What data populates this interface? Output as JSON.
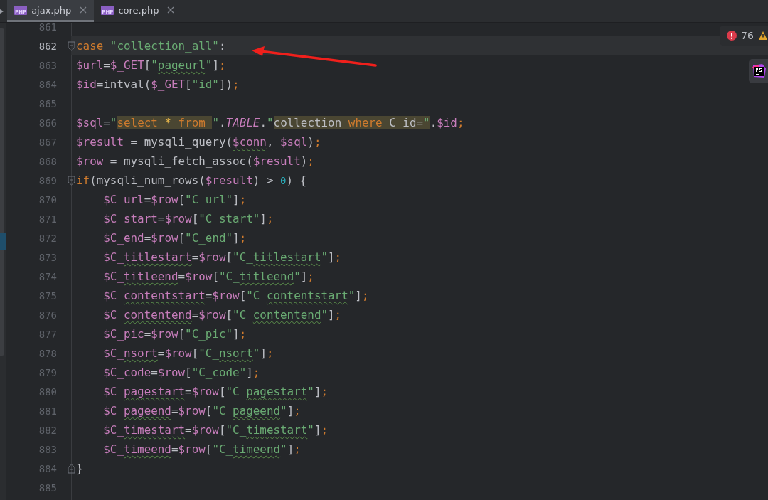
{
  "tabs": [
    {
      "label": "ajax.php",
      "badge": "PHP",
      "selected": true
    },
    {
      "label": "core.php",
      "badge": "PHP",
      "selected": false
    }
  ],
  "inspections": {
    "errors": "76"
  },
  "lines": [
    {
      "number": "861",
      "current": false,
      "fold_start": false,
      "fold_end": false
    },
    {
      "number": "862",
      "current": true,
      "fold_start": true,
      "fold_end": false,
      "tokens": [
        {
          "text": "case ",
          "kind": "kw"
        },
        {
          "text": "\"collection_all\"",
          "kind": "str"
        },
        {
          "text": ":",
          "kind": "plain"
        }
      ]
    },
    {
      "number": "863",
      "current": false,
      "fold_start": false,
      "fold_end": false,
      "tokens": [
        {
          "text": "$url",
          "kind": "var"
        },
        {
          "text": "=",
          "kind": "plain"
        },
        {
          "text": "$_GET",
          "kind": "var"
        },
        {
          "text": "[",
          "kind": "plain"
        },
        {
          "text": "\"",
          "kind": "str"
        },
        {
          "text": "pageurl",
          "kind": "str_typo"
        },
        {
          "text": "\"",
          "kind": "str"
        },
        {
          "text": "]",
          "kind": "plain"
        },
        {
          "text": ";",
          "kind": "punct"
        }
      ]
    },
    {
      "number": "864",
      "current": false,
      "fold_start": false,
      "fold_end": false,
      "tokens": [
        {
          "text": "$id",
          "kind": "var"
        },
        {
          "text": "=intval(",
          "kind": "plain"
        },
        {
          "text": "$_GET",
          "kind": "var"
        },
        {
          "text": "[",
          "kind": "plain"
        },
        {
          "text": "\"id\"",
          "kind": "str"
        },
        {
          "text": "])",
          "kind": "plain"
        },
        {
          "text": ";",
          "kind": "punct"
        }
      ]
    },
    {
      "number": "865",
      "current": false,
      "fold_start": false,
      "fold_end": false
    },
    {
      "number": "866",
      "current": false,
      "fold_start": false,
      "fold_end": false,
      "tokens": [
        {
          "text": "$sql",
          "kind": "var"
        },
        {
          "text": "=",
          "kind": "plain"
        },
        {
          "text": "\"",
          "kind": "str"
        },
        {
          "text": "select ",
          "kind": "sqlkw"
        },
        {
          "text": "* ",
          "kind": "sqlstar"
        },
        {
          "text": "from ",
          "kind": "sqlkw"
        },
        {
          "text": "\"",
          "kind": "str"
        },
        {
          "text": ".",
          "kind": "plain"
        },
        {
          "text": "TABLE",
          "kind": "const"
        },
        {
          "text": ".",
          "kind": "plain"
        },
        {
          "text": "\"",
          "kind": "str"
        },
        {
          "text": "collection ",
          "kind": "sqltext"
        },
        {
          "text": "where",
          "kind": "sqlkw"
        },
        {
          "text": " C_id=",
          "kind": "sqltext"
        },
        {
          "text": "\"",
          "kind": "sqlquote"
        },
        {
          "text": ".",
          "kind": "plain"
        },
        {
          "text": "$id",
          "kind": "var"
        },
        {
          "text": ";",
          "kind": "punct"
        }
      ]
    },
    {
      "number": "867",
      "current": false,
      "fold_start": false,
      "fold_end": false,
      "tokens": [
        {
          "text": "$result",
          "kind": "var"
        },
        {
          "text": " = mysqli_query(",
          "kind": "plain"
        },
        {
          "text": "$conn",
          "kind": "var_typo"
        },
        {
          "text": ", ",
          "kind": "plain"
        },
        {
          "text": "$sql",
          "kind": "var"
        },
        {
          "text": ")",
          "kind": "plain"
        },
        {
          "text": ";",
          "kind": "punct"
        }
      ]
    },
    {
      "number": "868",
      "current": false,
      "fold_start": false,
      "fold_end": false,
      "tokens": [
        {
          "text": "$row",
          "kind": "var"
        },
        {
          "text": " = mysqli_fetch_assoc(",
          "kind": "plain"
        },
        {
          "text": "$result",
          "kind": "var"
        },
        {
          "text": ")",
          "kind": "plain"
        },
        {
          "text": ";",
          "kind": "punct"
        }
      ]
    },
    {
      "number": "869",
      "current": false,
      "fold_start": true,
      "fold_end": false,
      "tokens": [
        {
          "text": "if",
          "kind": "kw"
        },
        {
          "text": "(mysqli_num_rows(",
          "kind": "plain"
        },
        {
          "text": "$result",
          "kind": "var"
        },
        {
          "text": ") > ",
          "kind": "plain"
        },
        {
          "text": "0",
          "kind": "num"
        },
        {
          "text": ") {",
          "kind": "plain"
        }
      ],
      "children": [
        {
          "number": "870",
          "current": false,
          "fold_start": false,
          "fold_end": false,
          "tokens": [
            {
              "text": "$C_url",
              "kind": "var"
            },
            {
              "text": "=",
              "kind": "plain"
            },
            {
              "text": "$row",
              "kind": "var"
            },
            {
              "text": "[",
              "kind": "plain"
            },
            {
              "text": "\"C_url\"",
              "kind": "str"
            },
            {
              "text": "]",
              "kind": "plain"
            },
            {
              "text": ";",
              "kind": "punct"
            }
          ]
        },
        {
          "number": "871",
          "current": false,
          "fold_start": false,
          "fold_end": false,
          "tokens": [
            {
              "text": "$C_start",
              "kind": "var"
            },
            {
              "text": "=",
              "kind": "plain"
            },
            {
              "text": "$row",
              "kind": "var"
            },
            {
              "text": "[",
              "kind": "plain"
            },
            {
              "text": "\"C_start\"",
              "kind": "str"
            },
            {
              "text": "]",
              "kind": "plain"
            },
            {
              "text": ";",
              "kind": "punct"
            }
          ]
        },
        {
          "number": "872",
          "current": false,
          "fold_start": false,
          "fold_end": false,
          "tokens": [
            {
              "text": "$C_end",
              "kind": "var"
            },
            {
              "text": "=",
              "kind": "plain"
            },
            {
              "text": "$row",
              "kind": "var"
            },
            {
              "text": "[",
              "kind": "plain"
            },
            {
              "text": "\"C_end\"",
              "kind": "str"
            },
            {
              "text": "]",
              "kind": "plain"
            },
            {
              "text": ";",
              "kind": "punct"
            }
          ]
        },
        {
          "number": "873",
          "current": false,
          "fold_start": false,
          "fold_end": false,
          "tokens": [
            {
              "text": "$C_",
              "kind": "var"
            },
            {
              "text": "titlestart",
              "kind": "var_typo"
            },
            {
              "text": "=",
              "kind": "plain"
            },
            {
              "text": "$row",
              "kind": "var"
            },
            {
              "text": "[",
              "kind": "plain"
            },
            {
              "text": "\"C_",
              "kind": "str"
            },
            {
              "text": "titlestart",
              "kind": "str_typo"
            },
            {
              "text": "\"",
              "kind": "str"
            },
            {
              "text": "]",
              "kind": "plain"
            },
            {
              "text": ";",
              "kind": "punct"
            }
          ]
        },
        {
          "number": "874",
          "current": false,
          "fold_start": false,
          "fold_end": false,
          "tokens": [
            {
              "text": "$C_",
              "kind": "var"
            },
            {
              "text": "titleend",
              "kind": "var_typo"
            },
            {
              "text": "=",
              "kind": "plain"
            },
            {
              "text": "$row",
              "kind": "var"
            },
            {
              "text": "[",
              "kind": "plain"
            },
            {
              "text": "\"C_",
              "kind": "str"
            },
            {
              "text": "titleend",
              "kind": "str_typo"
            },
            {
              "text": "\"",
              "kind": "str"
            },
            {
              "text": "]",
              "kind": "plain"
            },
            {
              "text": ";",
              "kind": "punct"
            }
          ]
        },
        {
          "number": "875",
          "current": false,
          "fold_start": false,
          "fold_end": false,
          "tokens": [
            {
              "text": "$C_",
              "kind": "var"
            },
            {
              "text": "contentstart",
              "kind": "var_typo"
            },
            {
              "text": "=",
              "kind": "plain"
            },
            {
              "text": "$row",
              "kind": "var"
            },
            {
              "text": "[",
              "kind": "plain"
            },
            {
              "text": "\"C_",
              "kind": "str"
            },
            {
              "text": "contentstart",
              "kind": "str_typo"
            },
            {
              "text": "\"",
              "kind": "str"
            },
            {
              "text": "]",
              "kind": "plain"
            },
            {
              "text": ";",
              "kind": "punct"
            }
          ]
        },
        {
          "number": "876",
          "current": false,
          "fold_start": false,
          "fold_end": false,
          "tokens": [
            {
              "text": "$C_",
              "kind": "var"
            },
            {
              "text": "contentend",
              "kind": "var_typo"
            },
            {
              "text": "=",
              "kind": "plain"
            },
            {
              "text": "$row",
              "kind": "var"
            },
            {
              "text": "[",
              "kind": "plain"
            },
            {
              "text": "\"C_",
              "kind": "str"
            },
            {
              "text": "contentend",
              "kind": "str_typo"
            },
            {
              "text": "\"",
              "kind": "str"
            },
            {
              "text": "]",
              "kind": "plain"
            },
            {
              "text": ";",
              "kind": "punct"
            }
          ]
        },
        {
          "number": "877",
          "current": false,
          "fold_start": false,
          "fold_end": false,
          "tokens": [
            {
              "text": "$C_pic",
              "kind": "var"
            },
            {
              "text": "=",
              "kind": "plain"
            },
            {
              "text": "$row",
              "kind": "var"
            },
            {
              "text": "[",
              "kind": "plain"
            },
            {
              "text": "\"C_pic\"",
              "kind": "str"
            },
            {
              "text": "]",
              "kind": "plain"
            },
            {
              "text": ";",
              "kind": "punct"
            }
          ]
        },
        {
          "number": "878",
          "current": false,
          "fold_start": false,
          "fold_end": false,
          "tokens": [
            {
              "text": "$C_",
              "kind": "var"
            },
            {
              "text": "nsort",
              "kind": "var_typo"
            },
            {
              "text": "=",
              "kind": "plain"
            },
            {
              "text": "$row",
              "kind": "var"
            },
            {
              "text": "[",
              "kind": "plain"
            },
            {
              "text": "\"C_",
              "kind": "str"
            },
            {
              "text": "nsort",
              "kind": "str_typo"
            },
            {
              "text": "\"",
              "kind": "str"
            },
            {
              "text": "]",
              "kind": "plain"
            },
            {
              "text": ";",
              "kind": "punct"
            }
          ]
        },
        {
          "number": "879",
          "current": false,
          "fold_start": false,
          "fold_end": false,
          "tokens": [
            {
              "text": "$C_code",
              "kind": "var"
            },
            {
              "text": "=",
              "kind": "plain"
            },
            {
              "text": "$row",
              "kind": "var"
            },
            {
              "text": "[",
              "kind": "plain"
            },
            {
              "text": "\"C_code\"",
              "kind": "str"
            },
            {
              "text": "]",
              "kind": "plain"
            },
            {
              "text": ";",
              "kind": "punct"
            }
          ]
        },
        {
          "number": "880",
          "current": false,
          "fold_start": false,
          "fold_end": false,
          "tokens": [
            {
              "text": "$C_",
              "kind": "var"
            },
            {
              "text": "pagestart",
              "kind": "var_typo"
            },
            {
              "text": "=",
              "kind": "plain"
            },
            {
              "text": "$row",
              "kind": "var"
            },
            {
              "text": "[",
              "kind": "plain"
            },
            {
              "text": "\"C_",
              "kind": "str"
            },
            {
              "text": "pagestart",
              "kind": "str_typo"
            },
            {
              "text": "\"",
              "kind": "str"
            },
            {
              "text": "]",
              "kind": "plain"
            },
            {
              "text": ";",
              "kind": "punct"
            }
          ]
        },
        {
          "number": "881",
          "current": false,
          "fold_start": false,
          "fold_end": false,
          "tokens": [
            {
              "text": "$C_",
              "kind": "var"
            },
            {
              "text": "pageend",
              "kind": "var_typo"
            },
            {
              "text": "=",
              "kind": "plain"
            },
            {
              "text": "$row",
              "kind": "var"
            },
            {
              "text": "[",
              "kind": "plain"
            },
            {
              "text": "\"C_",
              "kind": "str"
            },
            {
              "text": "pageend",
              "kind": "str_typo"
            },
            {
              "text": "\"",
              "kind": "str"
            },
            {
              "text": "]",
              "kind": "plain"
            },
            {
              "text": ";",
              "kind": "punct"
            }
          ]
        },
        {
          "number": "882",
          "current": false,
          "fold_start": false,
          "fold_end": false,
          "tokens": [
            {
              "text": "$C_",
              "kind": "var"
            },
            {
              "text": "timestart",
              "kind": "var_typo"
            },
            {
              "text": "=",
              "kind": "plain"
            },
            {
              "text": "$row",
              "kind": "var"
            },
            {
              "text": "[",
              "kind": "plain"
            },
            {
              "text": "\"C_",
              "kind": "str"
            },
            {
              "text": "timestart",
              "kind": "str_typo"
            },
            {
              "text": "\"",
              "kind": "str"
            },
            {
              "text": "]",
              "kind": "plain"
            },
            {
              "text": ";",
              "kind": "punct"
            }
          ]
        },
        {
          "number": "883",
          "current": false,
          "fold_start": false,
          "fold_end": false,
          "tokens": [
            {
              "text": "$C_",
              "kind": "var"
            },
            {
              "text": "timeend",
              "kind": "var_typo"
            },
            {
              "text": "=",
              "kind": "plain"
            },
            {
              "text": "$row",
              "kind": "var"
            },
            {
              "text": "[",
              "kind": "plain"
            },
            {
              "text": "\"C_",
              "kind": "str"
            },
            {
              "text": "timeend",
              "kind": "str_typo"
            },
            {
              "text": "\"",
              "kind": "str"
            },
            {
              "text": "]",
              "kind": "plain"
            },
            {
              "text": ";",
              "kind": "punct"
            }
          ]
        }
      ]
    },
    {
      "number": "884",
      "current": false,
      "fold_start": false,
      "fold_end": true,
      "tokens": [
        {
          "text": "}",
          "kind": "plain"
        }
      ]
    },
    {
      "number": "885",
      "current": false,
      "fold_start": false,
      "fold_end": false
    }
  ]
}
